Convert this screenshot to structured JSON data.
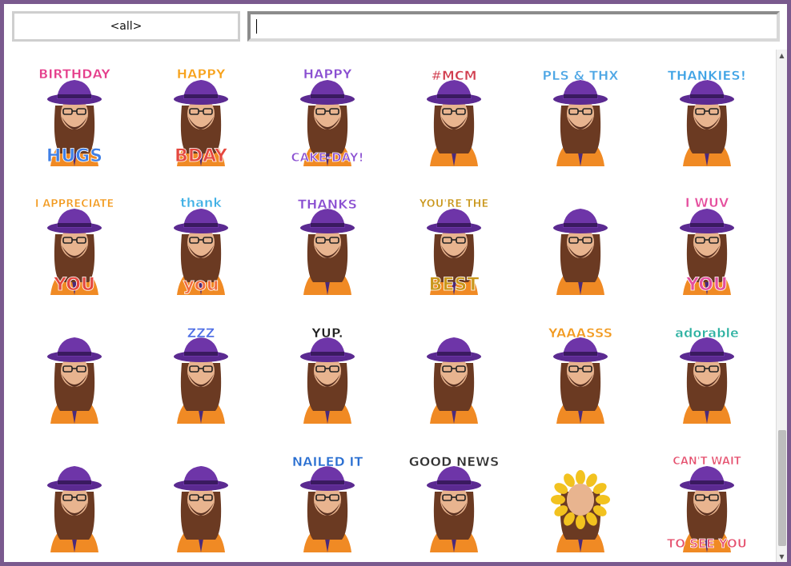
{
  "category_select": {
    "value": "<all>"
  },
  "search": {
    "value": "",
    "placeholder": ""
  },
  "scrollbar": {
    "up_arrow": "▲",
    "down_arrow": "▼",
    "position": 0.82
  },
  "stickers": [
    {
      "name": "birthday-hugs",
      "lines": [
        "BIRTHDAY",
        "HUGS"
      ],
      "colors": [
        "#e53f8c",
        "#3f7fe5"
      ],
      "hat": true
    },
    {
      "name": "happy-bday-card",
      "lines": [
        "HAPPY",
        "BDAY"
      ],
      "colors": [
        "#f7a21b",
        "#e5483f"
      ],
      "hat": true
    },
    {
      "name": "happy-cake-day",
      "lines": [
        "HAPPY",
        "CAKE-DAY!"
      ],
      "colors": [
        "#8a4fd1",
        "#8a4fd1"
      ],
      "hat": true
    },
    {
      "name": "mcm-sign",
      "lines": [
        "#MCM",
        ""
      ],
      "colors": [
        "#d13e4f",
        "#d13e4f"
      ],
      "hat": true
    },
    {
      "name": "pls-thx",
      "lines": [
        "PLS & THX",
        ""
      ],
      "colors": [
        "#4fa7e5",
        "#e54f9e"
      ],
      "hat": true
    },
    {
      "name": "thankies",
      "lines": [
        "THANKIES!",
        ""
      ],
      "colors": [
        "#3fa3e5",
        "#3fa3e5"
      ],
      "hat": true
    },
    {
      "name": "i-appreciate-you",
      "lines": [
        "I APPRECIATE",
        "YOU"
      ],
      "colors": [
        "#f29a1f",
        "#e5483f"
      ],
      "hat": true
    },
    {
      "name": "thank-you",
      "lines": [
        "thank",
        "you"
      ],
      "colors": [
        "#3fb0e5",
        "#f26d3f"
      ],
      "hat": true
    },
    {
      "name": "thanks",
      "lines": [
        "THANKS",
        ""
      ],
      "colors": [
        "#8a4fd1",
        "#8a4fd1"
      ],
      "hat": true
    },
    {
      "name": "youre-the-best",
      "lines": [
        "YOU'RE THE",
        "BEST"
      ],
      "colors": [
        "#c9961a",
        "#c9961a"
      ],
      "hat": true
    },
    {
      "name": "heart",
      "lines": [
        "",
        ""
      ],
      "colors": [
        "#d81b2a",
        "#d81b2a"
      ],
      "hat": true
    },
    {
      "name": "i-wuv-you",
      "lines": [
        "I WUV",
        "YOU"
      ],
      "colors": [
        "#e54f9e",
        "#e54f9e"
      ],
      "hat": true
    },
    {
      "name": "floating-love",
      "lines": [
        "",
        ""
      ],
      "colors": [
        "#f28ac2",
        "#f28ac2"
      ],
      "hat": true
    },
    {
      "name": "sleeping-zzz",
      "lines": [
        "ZZZ",
        ""
      ],
      "colors": [
        "#4f6fe5",
        "#4f6fe5"
      ],
      "hat": true
    },
    {
      "name": "yup-coffee",
      "lines": [
        "YUP.",
        ""
      ],
      "colors": [
        "#222222",
        "#222222"
      ],
      "hat": true
    },
    {
      "name": "checkmark-books",
      "lines": [
        "",
        ""
      ],
      "colors": [
        "#2a9d3f",
        "#3f6fe5"
      ],
      "hat": true
    },
    {
      "name": "yaaasss",
      "lines": [
        "YAAASSS",
        ""
      ],
      "colors": [
        "#f29a1f",
        "#f29a1f"
      ],
      "hat": true
    },
    {
      "name": "adorable",
      "lines": [
        "adorable",
        ""
      ],
      "colors": [
        "#2ab0a0",
        "#2ab0a0"
      ],
      "hat": true
    },
    {
      "name": "teacup",
      "lines": [
        "",
        ""
      ],
      "colors": [
        "#e54f6d",
        "#e54f6d"
      ],
      "hat": true
    },
    {
      "name": "boombox",
      "lines": [
        "",
        ""
      ],
      "colors": [
        "#e54f9e",
        "#5a3f8e"
      ],
      "hat": true
    },
    {
      "name": "nailed-it",
      "lines": [
        "NAILED IT",
        ""
      ],
      "colors": [
        "#2a6fd1",
        "#f29a1f"
      ],
      "hat": true
    },
    {
      "name": "good-news",
      "lines": [
        "GOOD NEWS",
        ""
      ],
      "colors": [
        "#333333",
        "#333333"
      ],
      "hat": true
    },
    {
      "name": "sunflower-guitar",
      "lines": [
        "",
        ""
      ],
      "colors": [
        "#f2c21f",
        "#3f8fe5"
      ],
      "hat": false
    },
    {
      "name": "cant-wait-to-see-you",
      "lines": [
        "CAN'T WAIT",
        "TO SEE YOU"
      ],
      "colors": [
        "#e54f6d",
        "#e54f6d"
      ],
      "hat": true
    }
  ]
}
